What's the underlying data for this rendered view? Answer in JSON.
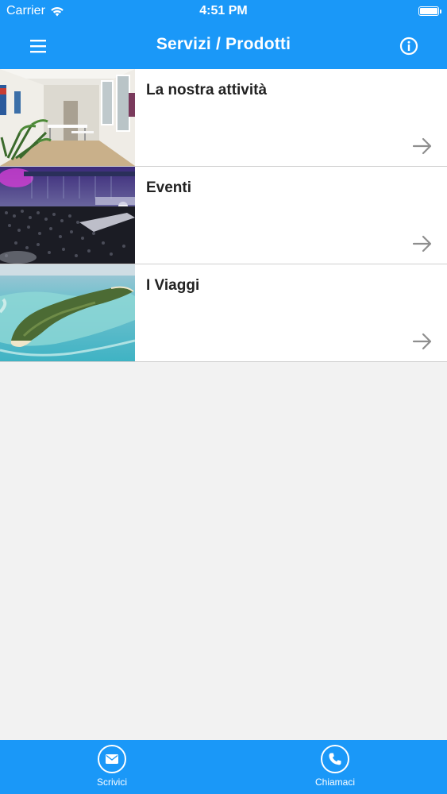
{
  "status_bar": {
    "carrier": "Carrier",
    "time": "4:51 PM",
    "wifi_icon": "wifi-icon",
    "battery_icon": "battery-icon"
  },
  "nav_bar": {
    "title": "Servizi / Prodotti",
    "left_icon": "menu-icon",
    "right_icon": "info-icon",
    "background_color": "#1a98f8"
  },
  "items": [
    {
      "title": "La nostra attività",
      "image": "office-interior-photo",
      "arrow_icon": "arrow-right-icon"
    },
    {
      "title": "Eventi",
      "image": "concert-crowd-photo",
      "arrow_icon": "arrow-right-icon"
    },
    {
      "title": "I Viaggi",
      "image": "tropical-island-photo",
      "arrow_icon": "arrow-right-icon"
    }
  ],
  "tab_bar": {
    "write": {
      "label": "Scrivici",
      "icon": "envelope-icon"
    },
    "call": {
      "label": "Chiamaci",
      "icon": "phone-icon"
    }
  }
}
